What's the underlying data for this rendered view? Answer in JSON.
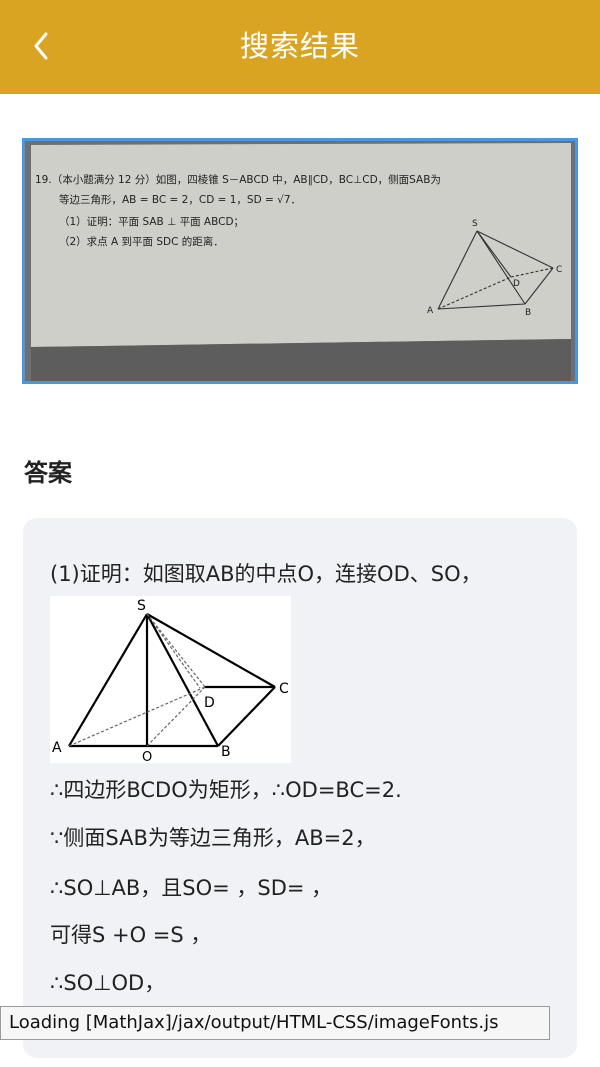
{
  "header": {
    "title": "搜索结果",
    "back_icon": "chevron-left-icon",
    "background": "#d8a422"
  },
  "question": {
    "line1": "19.（本小题满分 12 分）如图，四棱锥 S－ABCD 中，AB∥CD，BC⊥CD，侧面SAB为",
    "line2": "等边三角形，AB = BC = 2，CD = 1，SD = √7．",
    "part1": "（1）证明：平面 SAB ⊥ 平面 ABCD；",
    "part2": "（2）求点 A 到平面 SDC 的距离．",
    "labels": {
      "s": "S",
      "c": "C",
      "d": "D",
      "a": "A",
      "b": "B"
    }
  },
  "answer": {
    "heading": "答案",
    "lines": [
      "(1)证明：如图取AB的中点O，连接OD、SO，",
      "∴四边形BCDO为矩形，∴OD=BC=2.",
      "∵侧面SAB为等边三角形，AB=2，",
      "∴SO⊥AB，且SO= ，SD= ，",
      "可得S +O =S ，",
      "∴SO⊥OD，"
    ],
    "figure_labels": {
      "s": "S",
      "c": "C",
      "d": "D",
      "a": "A",
      "o": "O",
      "b": "B"
    }
  },
  "status_text": "Loading [MathJax]/jax/output/HTML-CSS/imageFonts.js"
}
